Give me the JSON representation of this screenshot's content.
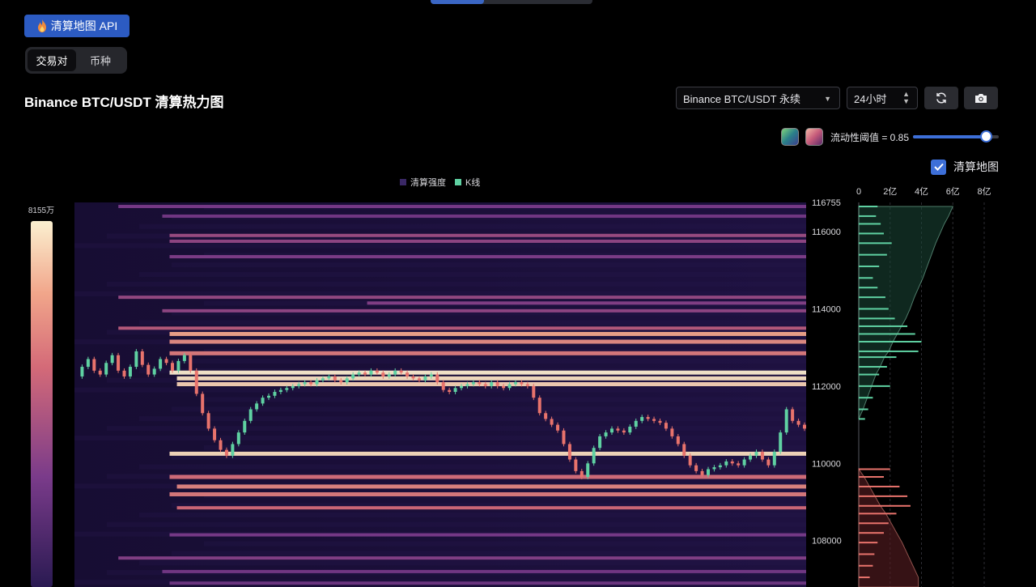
{
  "header": {
    "api_button_label": "清算地图 API",
    "tabs": [
      {
        "label": "交易对",
        "active": true
      },
      {
        "label": "币种",
        "active": false
      }
    ],
    "title": "Binance BTC/USDT 清算热力图"
  },
  "controls": {
    "pair_select_value": "Binance BTC/USDT 永续",
    "time_select_value": "24小时",
    "threshold_label": "流动性阈值 = 0.85",
    "threshold_value": 0.85,
    "map_checkbox_label": "清算地图",
    "map_checkbox_checked": true
  },
  "colors": {
    "accent": "#3d6fd8",
    "heat_low": "#2a1a52",
    "heat_high": "#fbf0d0",
    "candle_up": "#5fd1a2",
    "candle_down": "#e8736c",
    "profile_upper": "#5fd1a2",
    "profile_lower": "#e8736c"
  },
  "chart_data": {
    "type": "heatmap",
    "legend": [
      {
        "name": "清算强度",
        "color": "#3a2866"
      },
      {
        "name": "K线",
        "color": "#5fd1a2"
      }
    ],
    "colorbar_max_label": "8155万",
    "colorbar_max": 81550000,
    "y_ticks": [
      116755,
      116000,
      114000,
      112000,
      110000,
      108000
    ],
    "y_tick_labels": [
      "116755",
      "116000",
      "114000",
      "112000",
      "110000",
      "108000"
    ],
    "ylim": [
      106800,
      116755
    ],
    "profile_axis": {
      "ticks": [
        0,
        200000000,
        400000000,
        600000000,
        800000000
      ],
      "tick_labels": [
        "0",
        "2亿",
        "4亿",
        "6亿",
        "8亿"
      ]
    },
    "price_path": [
      112250,
      112500,
      112700,
      112400,
      112300,
      112600,
      112800,
      112400,
      112250,
      112500,
      112900,
      112550,
      112300,
      112450,
      112700,
      112600,
      112400,
      112650,
      112800,
      112400,
      111800,
      111300,
      110900,
      110600,
      110350,
      110200,
      110500,
      110800,
      111100,
      111400,
      111550,
      111700,
      111750,
      111850,
      111900,
      111950,
      112000,
      112050,
      112100,
      112050,
      112150,
      112200,
      112250,
      112150,
      112100,
      112200,
      112300,
      112350,
      112300,
      112400,
      112350,
      112250,
      112300,
      112400,
      112350,
      112250,
      112200,
      112150,
      112250,
      112300,
      112100,
      111900,
      111850,
      111950,
      112000,
      112050,
      112100,
      112050,
      112000,
      112100,
      112000,
      111950,
      112050,
      112100,
      112050,
      112000,
      111700,
      111300,
      111150,
      111000,
      110850,
      110500,
      110100,
      109800,
      109650,
      110000,
      110400,
      110700,
      110800,
      110900,
      110850,
      110800,
      110950,
      111100,
      111200,
      111150,
      111100,
      111050,
      110900,
      110700,
      110500,
      110200,
      109950,
      109800,
      109700,
      109850,
      109900,
      109950,
      110050,
      110000,
      109950,
      110100,
      110200,
      110300,
      110100,
      109950,
      110300,
      110800,
      111400,
      111100,
      111000,
      110900
    ],
    "bands": [
      {
        "price": 116650,
        "start": 0.06,
        "intensity": 0.3
      },
      {
        "price": 116400,
        "start": 0.12,
        "intensity": 0.28
      },
      {
        "price": 115900,
        "start": 0.13,
        "intensity": 0.42
      },
      {
        "price": 115750,
        "start": 0.13,
        "intensity": 0.38
      },
      {
        "price": 115350,
        "start": 0.13,
        "intensity": 0.32
      },
      {
        "price": 114300,
        "start": 0.06,
        "intensity": 0.4
      },
      {
        "price": 114150,
        "start": 0.4,
        "intensity": 0.34
      },
      {
        "price": 113950,
        "start": 0.12,
        "intensity": 0.38
      },
      {
        "price": 113500,
        "start": 0.06,
        "intensity": 0.52
      },
      {
        "price": 113350,
        "start": 0.13,
        "intensity": 0.8
      },
      {
        "price": 113150,
        "start": 0.13,
        "intensity": 0.72
      },
      {
        "price": 112850,
        "start": 0.13,
        "intensity": 0.66
      },
      {
        "price": 112350,
        "start": 0.13,
        "intensity": 0.99
      },
      {
        "price": 112200,
        "start": 0.14,
        "intensity": 0.96
      },
      {
        "price": 112050,
        "start": 0.14,
        "intensity": 0.92
      },
      {
        "price": 110250,
        "start": 0.13,
        "intensity": 0.95
      },
      {
        "price": 109650,
        "start": 0.13,
        "intensity": 0.62
      },
      {
        "price": 109400,
        "start": 0.14,
        "intensity": 0.7
      },
      {
        "price": 109200,
        "start": 0.13,
        "intensity": 0.66
      },
      {
        "price": 108850,
        "start": 0.14,
        "intensity": 0.6
      },
      {
        "price": 108150,
        "start": 0.13,
        "intensity": 0.3
      },
      {
        "price": 107550,
        "start": 0.06,
        "intensity": 0.34
      },
      {
        "price": 107200,
        "start": 0.12,
        "intensity": 0.28
      },
      {
        "price": 106900,
        "start": 0.13,
        "intensity": 0.26
      }
    ],
    "profile_upper": [
      [
        116650,
        120000000
      ],
      [
        116400,
        110000000
      ],
      [
        116200,
        140000000
      ],
      [
        115950,
        160000000
      ],
      [
        115700,
        210000000
      ],
      [
        115400,
        180000000
      ],
      [
        115100,
        130000000
      ],
      [
        114800,
        90000000
      ],
      [
        114550,
        120000000
      ],
      [
        114300,
        170000000
      ],
      [
        114000,
        190000000
      ],
      [
        113750,
        230000000
      ],
      [
        113550,
        310000000
      ],
      [
        113350,
        360000000
      ],
      [
        113150,
        400000000
      ],
      [
        112900,
        380000000
      ],
      [
        112750,
        240000000
      ],
      [
        112500,
        180000000
      ],
      [
        112300,
        130000000
      ],
      [
        112000,
        200000000
      ],
      [
        111700,
        90000000
      ],
      [
        111400,
        60000000
      ],
      [
        111150,
        40000000
      ]
    ],
    "profile_lower": [
      [
        109850,
        200000000
      ],
      [
        109650,
        160000000
      ],
      [
        109400,
        260000000
      ],
      [
        109150,
        310000000
      ],
      [
        108900,
        330000000
      ],
      [
        108700,
        240000000
      ],
      [
        108450,
        190000000
      ],
      [
        108200,
        160000000
      ],
      [
        107950,
        120000000
      ],
      [
        107650,
        100000000
      ],
      [
        107350,
        90000000
      ],
      [
        107050,
        70000000
      ]
    ]
  }
}
